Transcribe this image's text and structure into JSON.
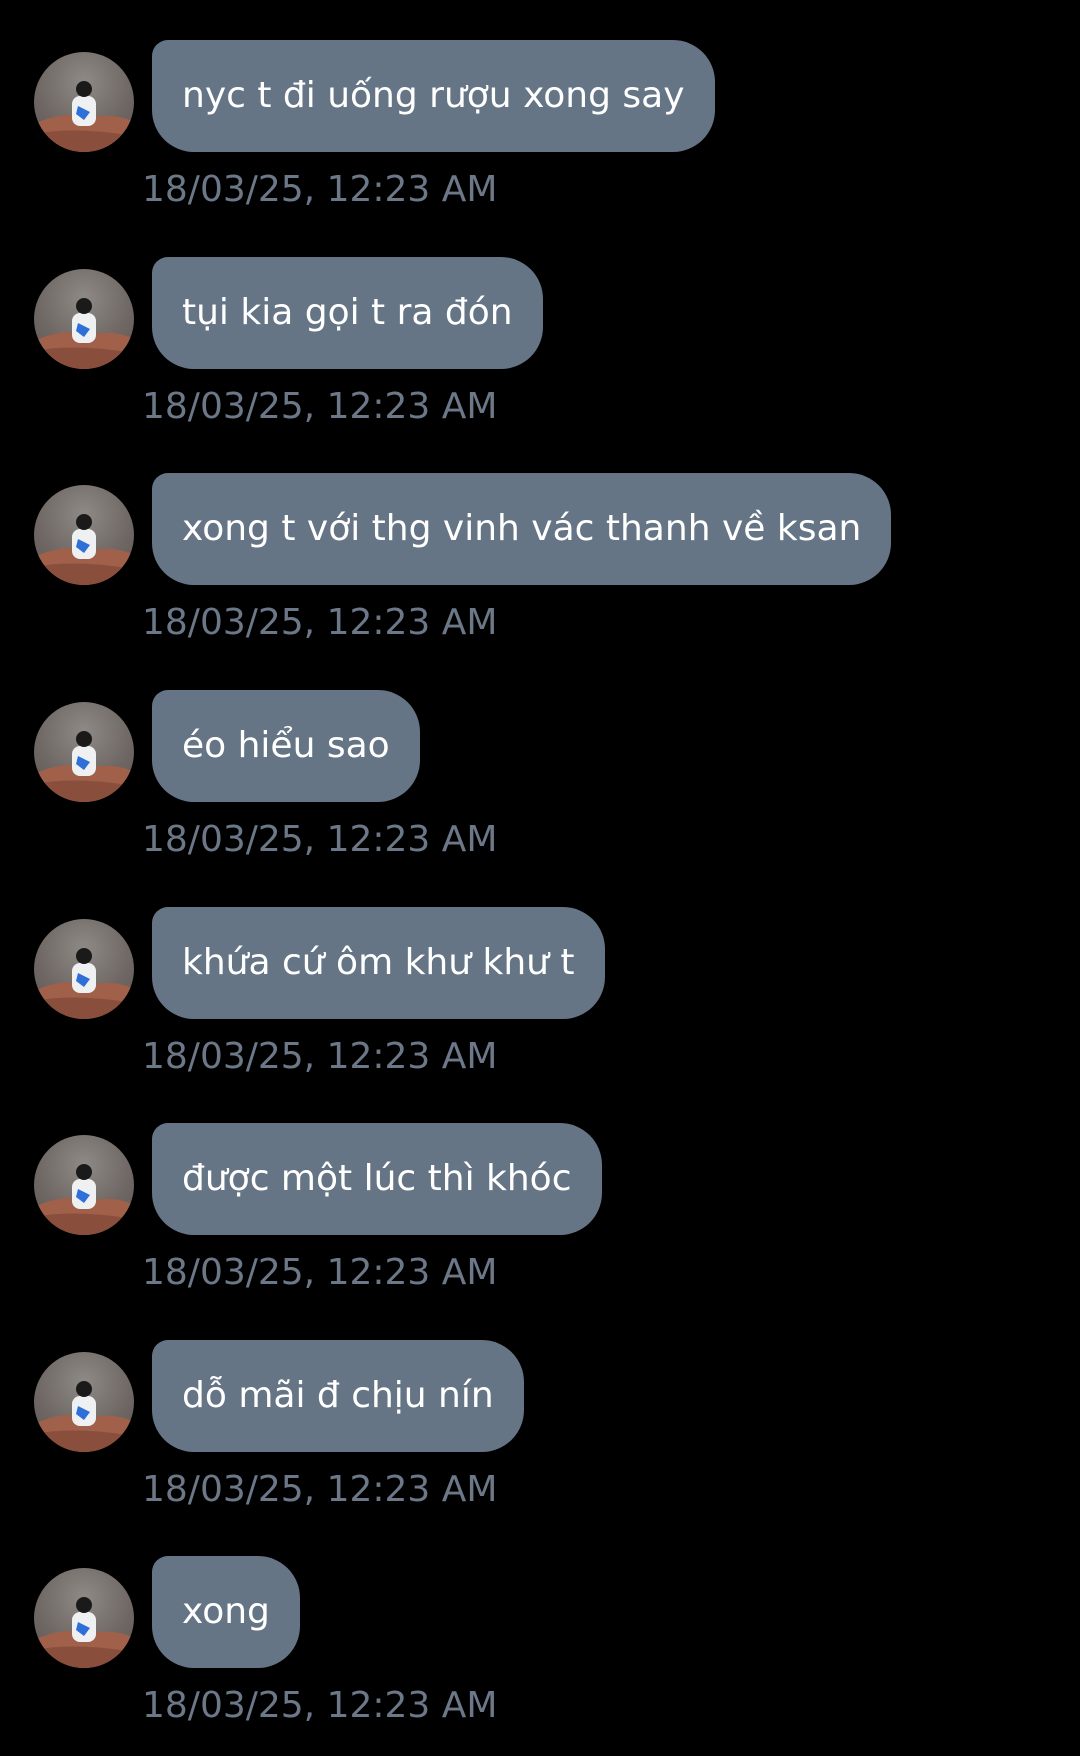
{
  "avatar_icon": "user-avatar-icon",
  "colors": {
    "background": "#000000",
    "bubble": "#657585",
    "bubble_text": "#ffffff",
    "timestamp_text": "#6c7888"
  },
  "messages": [
    {
      "text": "nyc t đi uống rượu xong say",
      "time": "18/03/25, 12:23 AM"
    },
    {
      "text": "tụi kia gọi t ra đón",
      "time": "18/03/25, 12:23 AM"
    },
    {
      "text": "xong t với thg vinh vác thanh về ksan",
      "time": "18/03/25, 12:23 AM"
    },
    {
      "text": "éo hiểu sao",
      "time": "18/03/25, 12:23 AM"
    },
    {
      "text": "khứa cứ ôm khư khư t",
      "time": "18/03/25, 12:23 AM"
    },
    {
      "text": "được một lúc thì khóc",
      "time": "18/03/25, 12:23 AM"
    },
    {
      "text": "dỗ mãi đ chịu nín",
      "time": "18/03/25, 12:23 AM"
    },
    {
      "text": "xong",
      "time": "18/03/25, 12:23 AM"
    }
  ]
}
